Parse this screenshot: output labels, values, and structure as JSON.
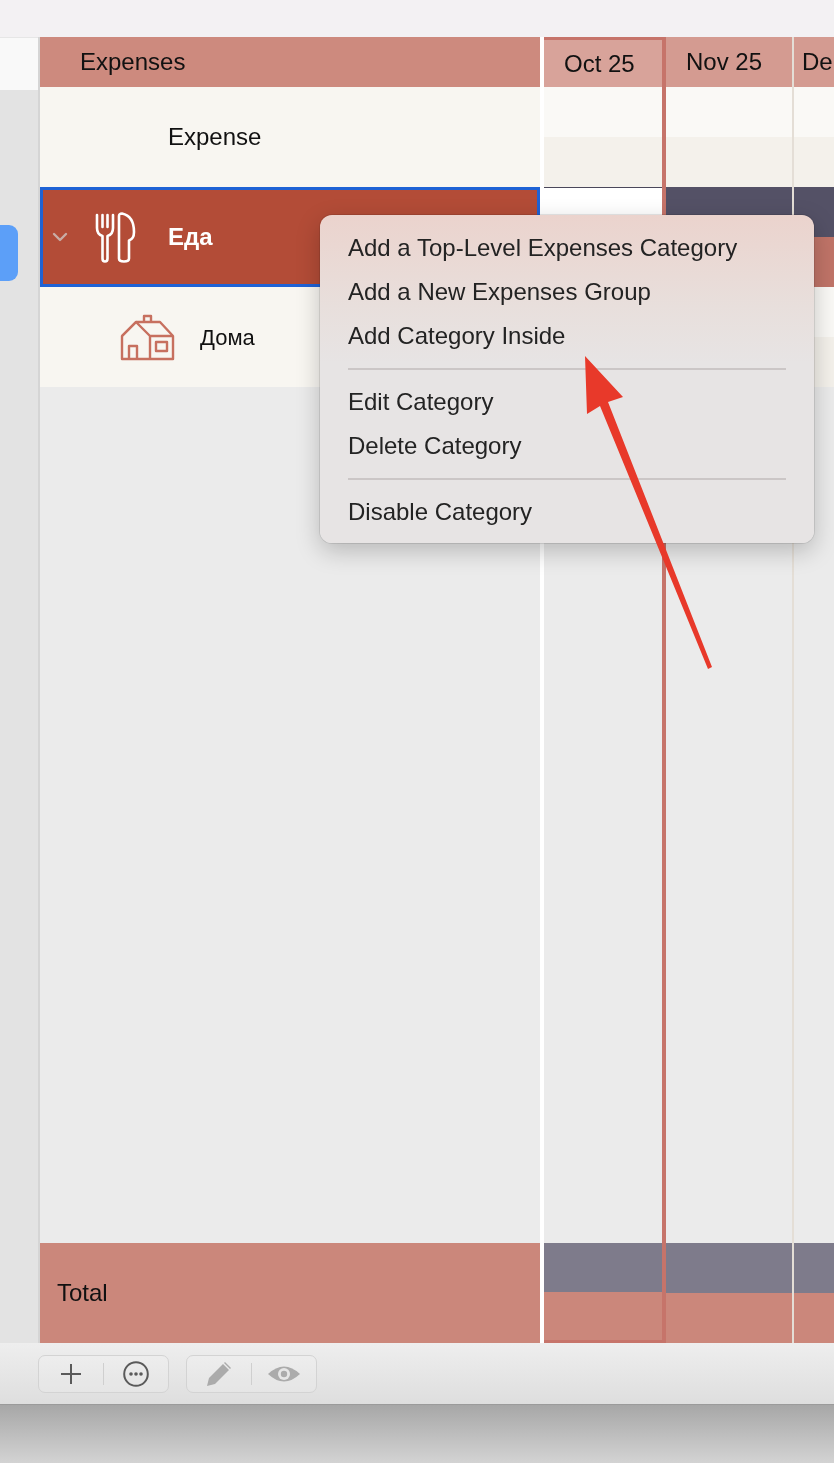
{
  "sidebar": {
    "items": [
      {
        "selected": true
      }
    ]
  },
  "table": {
    "heading": "Expenses",
    "columns": [
      {
        "label": "Oct 25",
        "current": true
      },
      {
        "label": "Nov 25",
        "current": false
      },
      {
        "label": "De",
        "current": false
      }
    ],
    "rows": [
      {
        "kind": "group",
        "label": "Expense",
        "selected": false
      },
      {
        "kind": "category",
        "label": "Еда",
        "selected": true,
        "expanded": true,
        "children": [
          {
            "kind": "subcategory",
            "label": "Дома",
            "selected": false
          }
        ]
      }
    ],
    "total": {
      "label": "Total"
    }
  },
  "context_menu": {
    "groups": [
      {
        "items": [
          {
            "label": "Add a Top-Level Expenses Category"
          },
          {
            "label": "Add a New Expenses Group"
          },
          {
            "label": "Add Category Inside"
          }
        ]
      },
      {
        "items": [
          {
            "label": "Edit Category"
          },
          {
            "label": "Delete Category"
          }
        ]
      },
      {
        "items": [
          {
            "label": "Disable Category"
          }
        ]
      }
    ]
  },
  "toolbar": {
    "groups": [
      {
        "items": [
          {
            "kind": "add",
            "disabled": false
          },
          {
            "kind": "more",
            "disabled": false
          }
        ]
      },
      {
        "items": [
          {
            "kind": "edit",
            "disabled": true
          },
          {
            "kind": "view",
            "disabled": true
          }
        ]
      }
    ]
  },
  "annotations": [
    {
      "kind": "arrow"
    }
  ]
}
